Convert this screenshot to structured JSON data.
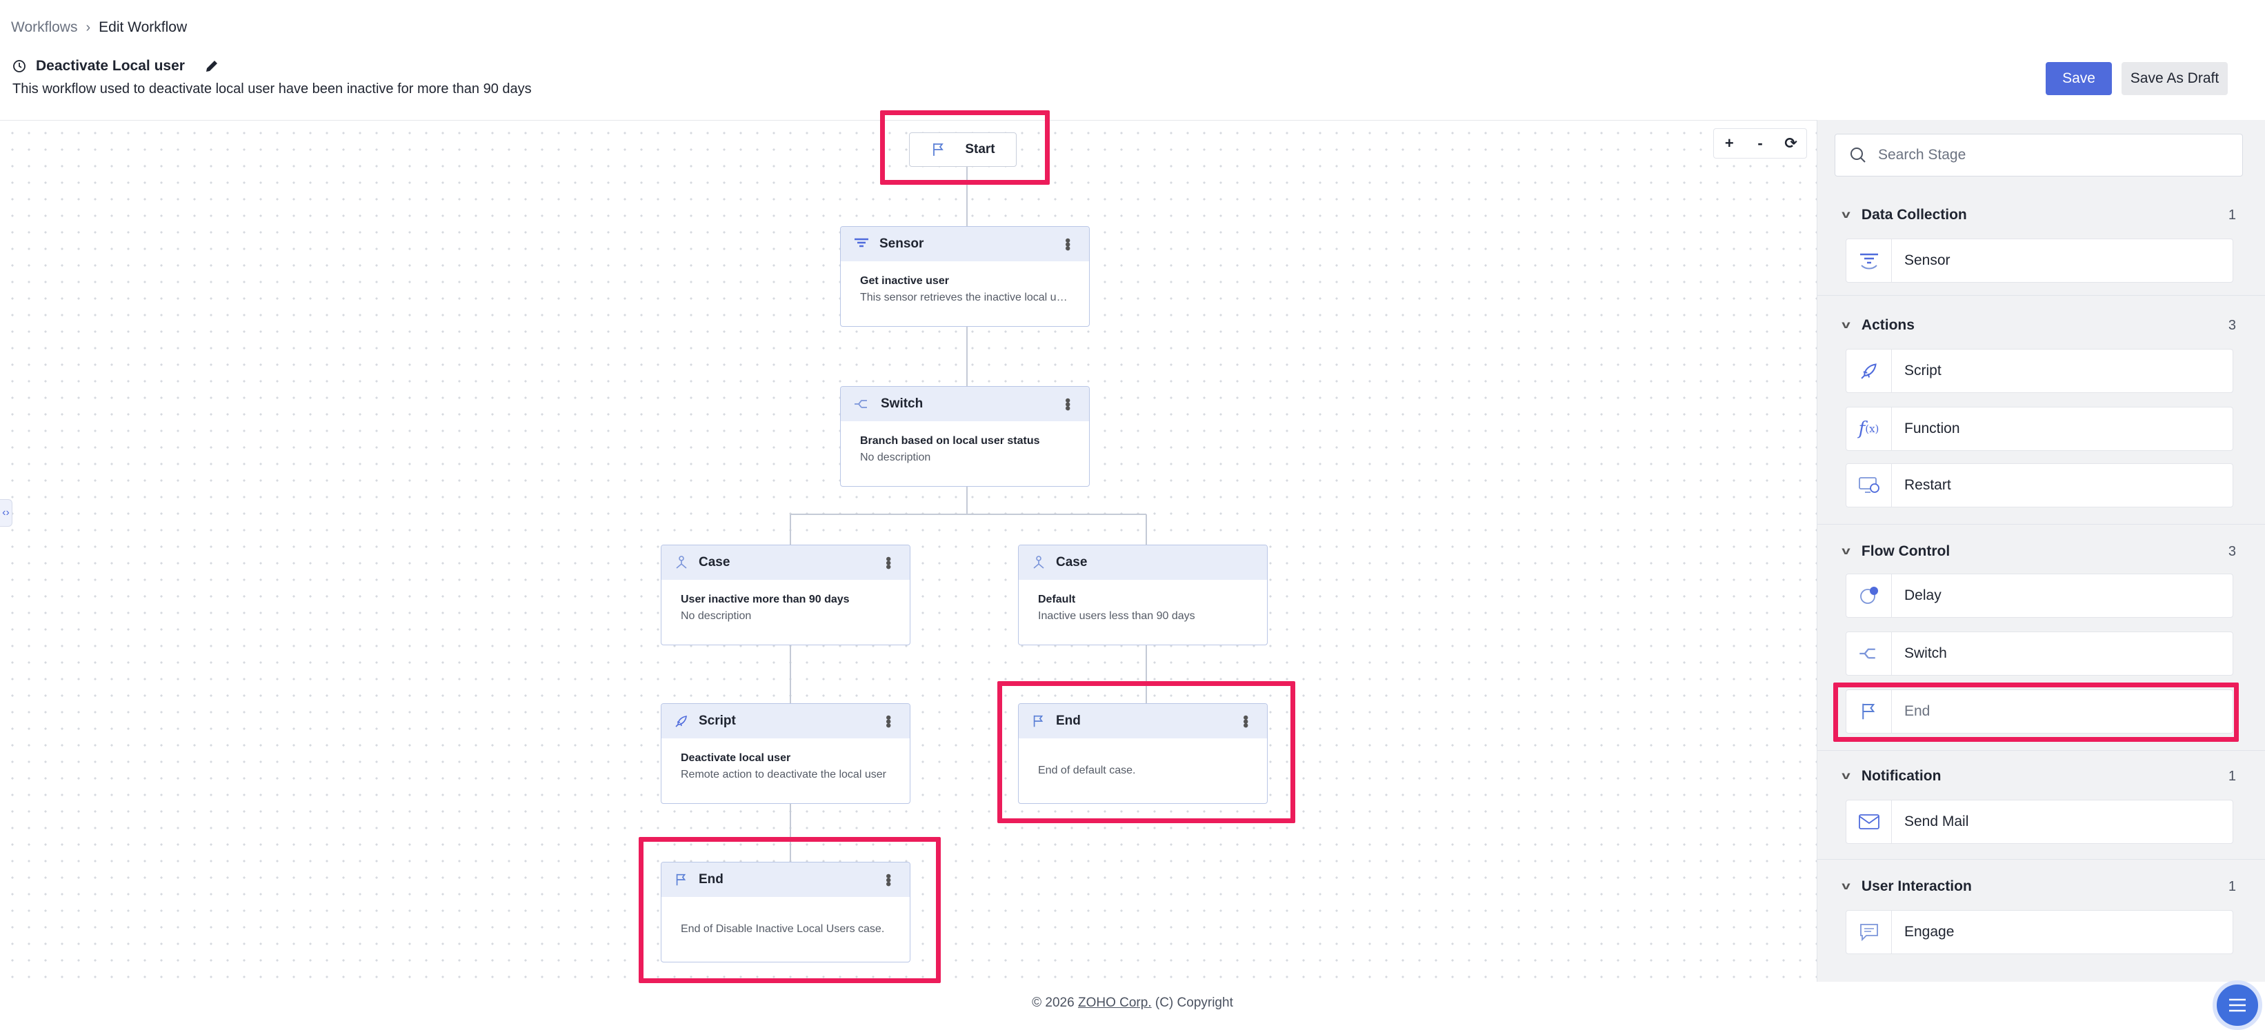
{
  "breadcrumb": {
    "root": "Workflows",
    "current": "Edit Workflow"
  },
  "workflow": {
    "title": "Deactivate Local user",
    "description": "This workflow used to deactivate local user have been inactive for more than 90 days"
  },
  "toolbar": {
    "save_label": "Save",
    "draft_label": "Save As Draft"
  },
  "zoom": {
    "in": "+",
    "out": "-"
  },
  "flow": {
    "start": "Start",
    "sensor": {
      "type": "Sensor",
      "name": "Get inactive user",
      "desc": "This sensor retrieves the inactive local us..."
    },
    "switch": {
      "type": "Switch",
      "name": "Branch based on local user status",
      "desc": "No description"
    },
    "case1": {
      "type": "Case",
      "name": "User inactive more than 90 days",
      "desc": "No description"
    },
    "case2": {
      "type": "Case",
      "name": "Default",
      "desc": "Inactive users less than 90 days"
    },
    "script": {
      "type": "Script",
      "name": "Deactivate local user",
      "desc": "Remote action to deactivate the local user"
    },
    "end_default": {
      "type": "End",
      "desc": "End of default case."
    },
    "end_main": {
      "type": "End",
      "desc": "End of Disable Inactive Local Users case."
    }
  },
  "panel": {
    "search_placeholder": "Search Stage",
    "categories": [
      {
        "name": "Data Collection",
        "count": "1",
        "items": [
          "Sensor"
        ]
      },
      {
        "name": "Actions",
        "count": "3",
        "items": [
          "Script",
          "Function",
          "Restart"
        ]
      },
      {
        "name": "Flow Control",
        "count": "3",
        "items": [
          "Delay",
          "Switch",
          "End"
        ]
      },
      {
        "name": "Notification",
        "count": "1",
        "items": [
          "Send Mail"
        ]
      },
      {
        "name": "User Interaction",
        "count": "1",
        "items": [
          "Engage"
        ]
      }
    ]
  },
  "footer": {
    "prefix": "© 2026",
    "company": "ZOHO Corp.",
    "suffix": "(C) Copyright"
  },
  "colors": {
    "accent": "#4f6bdc",
    "highlight": "#ec1c5a",
    "node_header": "#e8edf9"
  }
}
